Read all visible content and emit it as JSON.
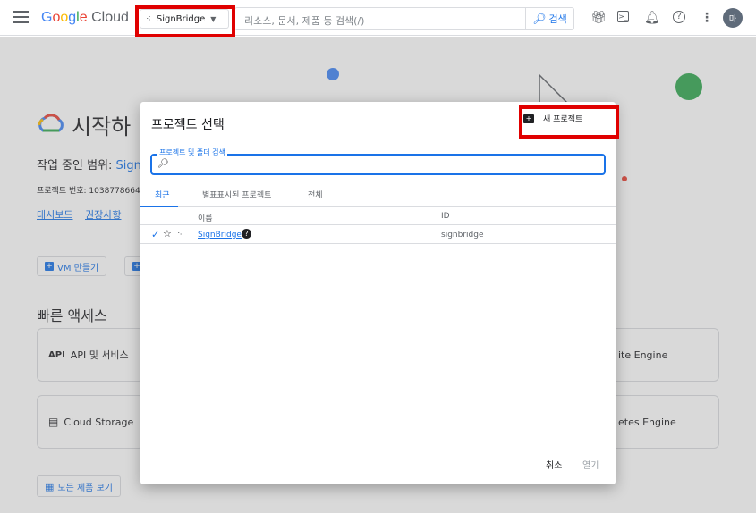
{
  "topbar": {
    "logo": "Google Cloud",
    "project_selector": "SignBridge",
    "search_placeholder": "리소스, 문서, 제품 등 검색(/)",
    "search_button": "검색",
    "avatar_initial": "마"
  },
  "background": {
    "title": "시작하",
    "scope_label": "작업 중인 범위:",
    "scope_value": "Sign",
    "project_number": "프로젝트 번호: 1038778664",
    "links": [
      "대시보드",
      "권장사항"
    ],
    "create_vm": "VM 만들기",
    "quick_access": "빠른 액세스",
    "cards": [
      "API 및 서비스",
      "Cloud Storage",
      "ite Engine",
      "etes Engine"
    ],
    "all_products": "모든 제품 보기",
    "api_glyph": "API"
  },
  "modal": {
    "title": "프로젝트 선택",
    "new_project": "새 프로젝트",
    "search_label": "프로젝트 및 폴더 검색",
    "tabs": [
      "최근",
      "별표표시된 프로젝트",
      "전체"
    ],
    "columns": {
      "name": "이름",
      "id": "ID"
    },
    "rows": [
      {
        "name": "SignBridge",
        "id": "signbridge"
      }
    ],
    "cancel": "취소",
    "open": "열기"
  },
  "colors": {
    "accent": "#1a73e8",
    "highlight": "#e00000"
  }
}
